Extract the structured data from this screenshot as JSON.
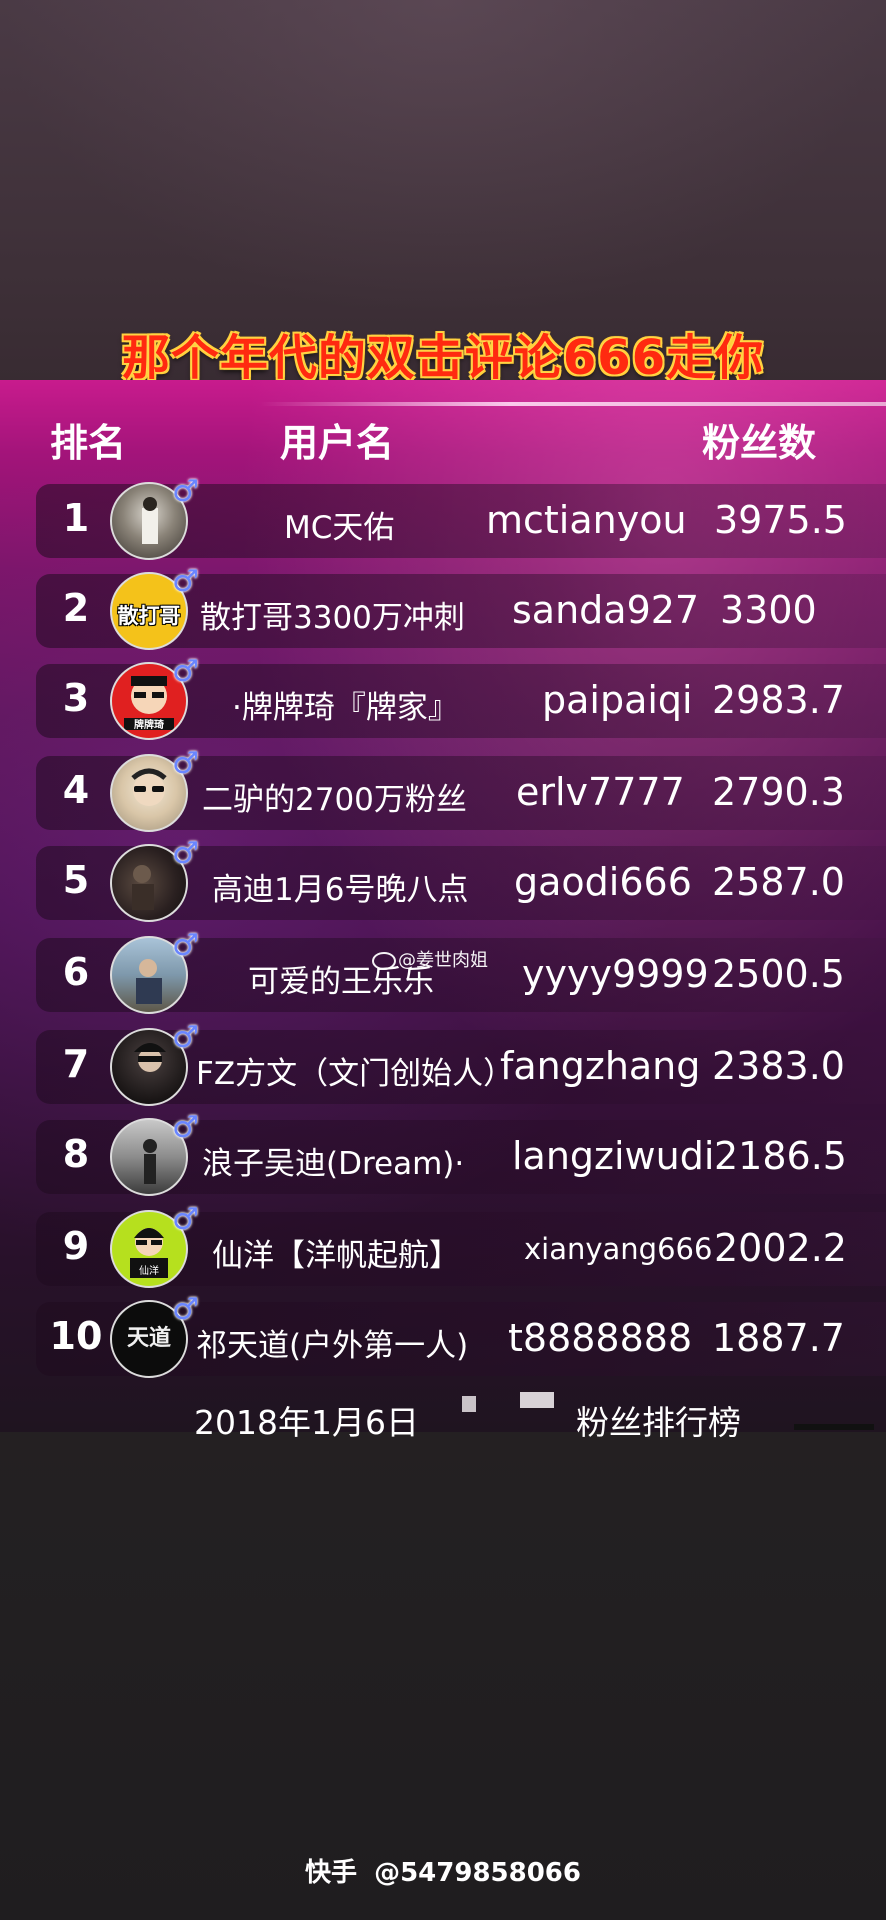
{
  "title": "那个年代的双击评论666走你",
  "headers": {
    "rank": "排名",
    "username": "用户名",
    "fans": "粉丝数"
  },
  "rows": [
    {
      "rank": "1",
      "nickname": "MC天佑",
      "userid": "mctianyou",
      "fans": "3975.5",
      "gender": "♂"
    },
    {
      "rank": "2",
      "nickname": "散打哥3300万冲刺",
      "userid": "sanda927",
      "fans": "3300",
      "gender": "♂",
      "avatar_text": "散打哥"
    },
    {
      "rank": "3",
      "nickname": "·牌牌琦『牌家』",
      "userid": "paipaiqi",
      "fans": "2983.7",
      "gender": "♂",
      "avatar_text": "牌牌琦"
    },
    {
      "rank": "4",
      "nickname": "二驴的2700万粉丝",
      "userid": "erlv7777",
      "fans": "2790.3",
      "gender": "♂"
    },
    {
      "rank": "5",
      "nickname": "高迪1月6号晚八点",
      "userid": "gaodi666",
      "fans": "2587.0",
      "gender": "♂"
    },
    {
      "rank": "6",
      "nickname": "可爱的王乐乐",
      "userid": "yyyy9999",
      "fans": "2500.5",
      "gender": "♂"
    },
    {
      "rank": "7",
      "nickname": "FZ方文（文门创始人）",
      "userid": "fangzhang",
      "fans": "2383.0",
      "gender": "♂"
    },
    {
      "rank": "8",
      "nickname": "浪子吴迪(Dream)·",
      "userid": "langziwudi",
      "fans": "2186.5",
      "gender": "♂"
    },
    {
      "rank": "9",
      "nickname": "仙洋【洋帆起航】",
      "userid": "xianyang666",
      "fans": "2002.2",
      "gender": "♂",
      "avatar_text": "仙洋"
    },
    {
      "rank": "10",
      "nickname": "祁天道(户外第一人)",
      "userid": "t8888888",
      "fans": "1887.7",
      "gender": "♂",
      "avatar_text": "天道"
    }
  ],
  "footer": {
    "date": "2018年1月6日",
    "label": "粉丝排行榜"
  },
  "watermark": "@姜世肉姐",
  "kuaishou": {
    "app": "快手",
    "id": "@5479858066"
  },
  "colors": {
    "title": "#ff2a10",
    "title_outline": "#ffcf3a",
    "board_top": "#c81b8d",
    "gender": "#6a86ff"
  }
}
